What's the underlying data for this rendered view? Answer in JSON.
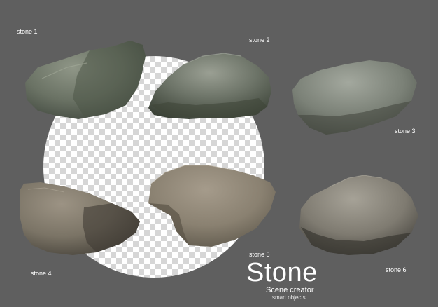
{
  "labels": {
    "stone1": "stone 1",
    "stone2": "stone 2",
    "stone3": "stone 3",
    "stone4": "stone 4",
    "stone5": "stone 5",
    "stone6": "stone 6"
  },
  "title": {
    "main": "Stone",
    "subtitle": "Scene creator",
    "tagline": "smart objects"
  },
  "colors": {
    "background": "#5f5f5f",
    "stone_green": "#6e7567",
    "stone_tan": "#8a8273",
    "text": "#ffffff"
  }
}
